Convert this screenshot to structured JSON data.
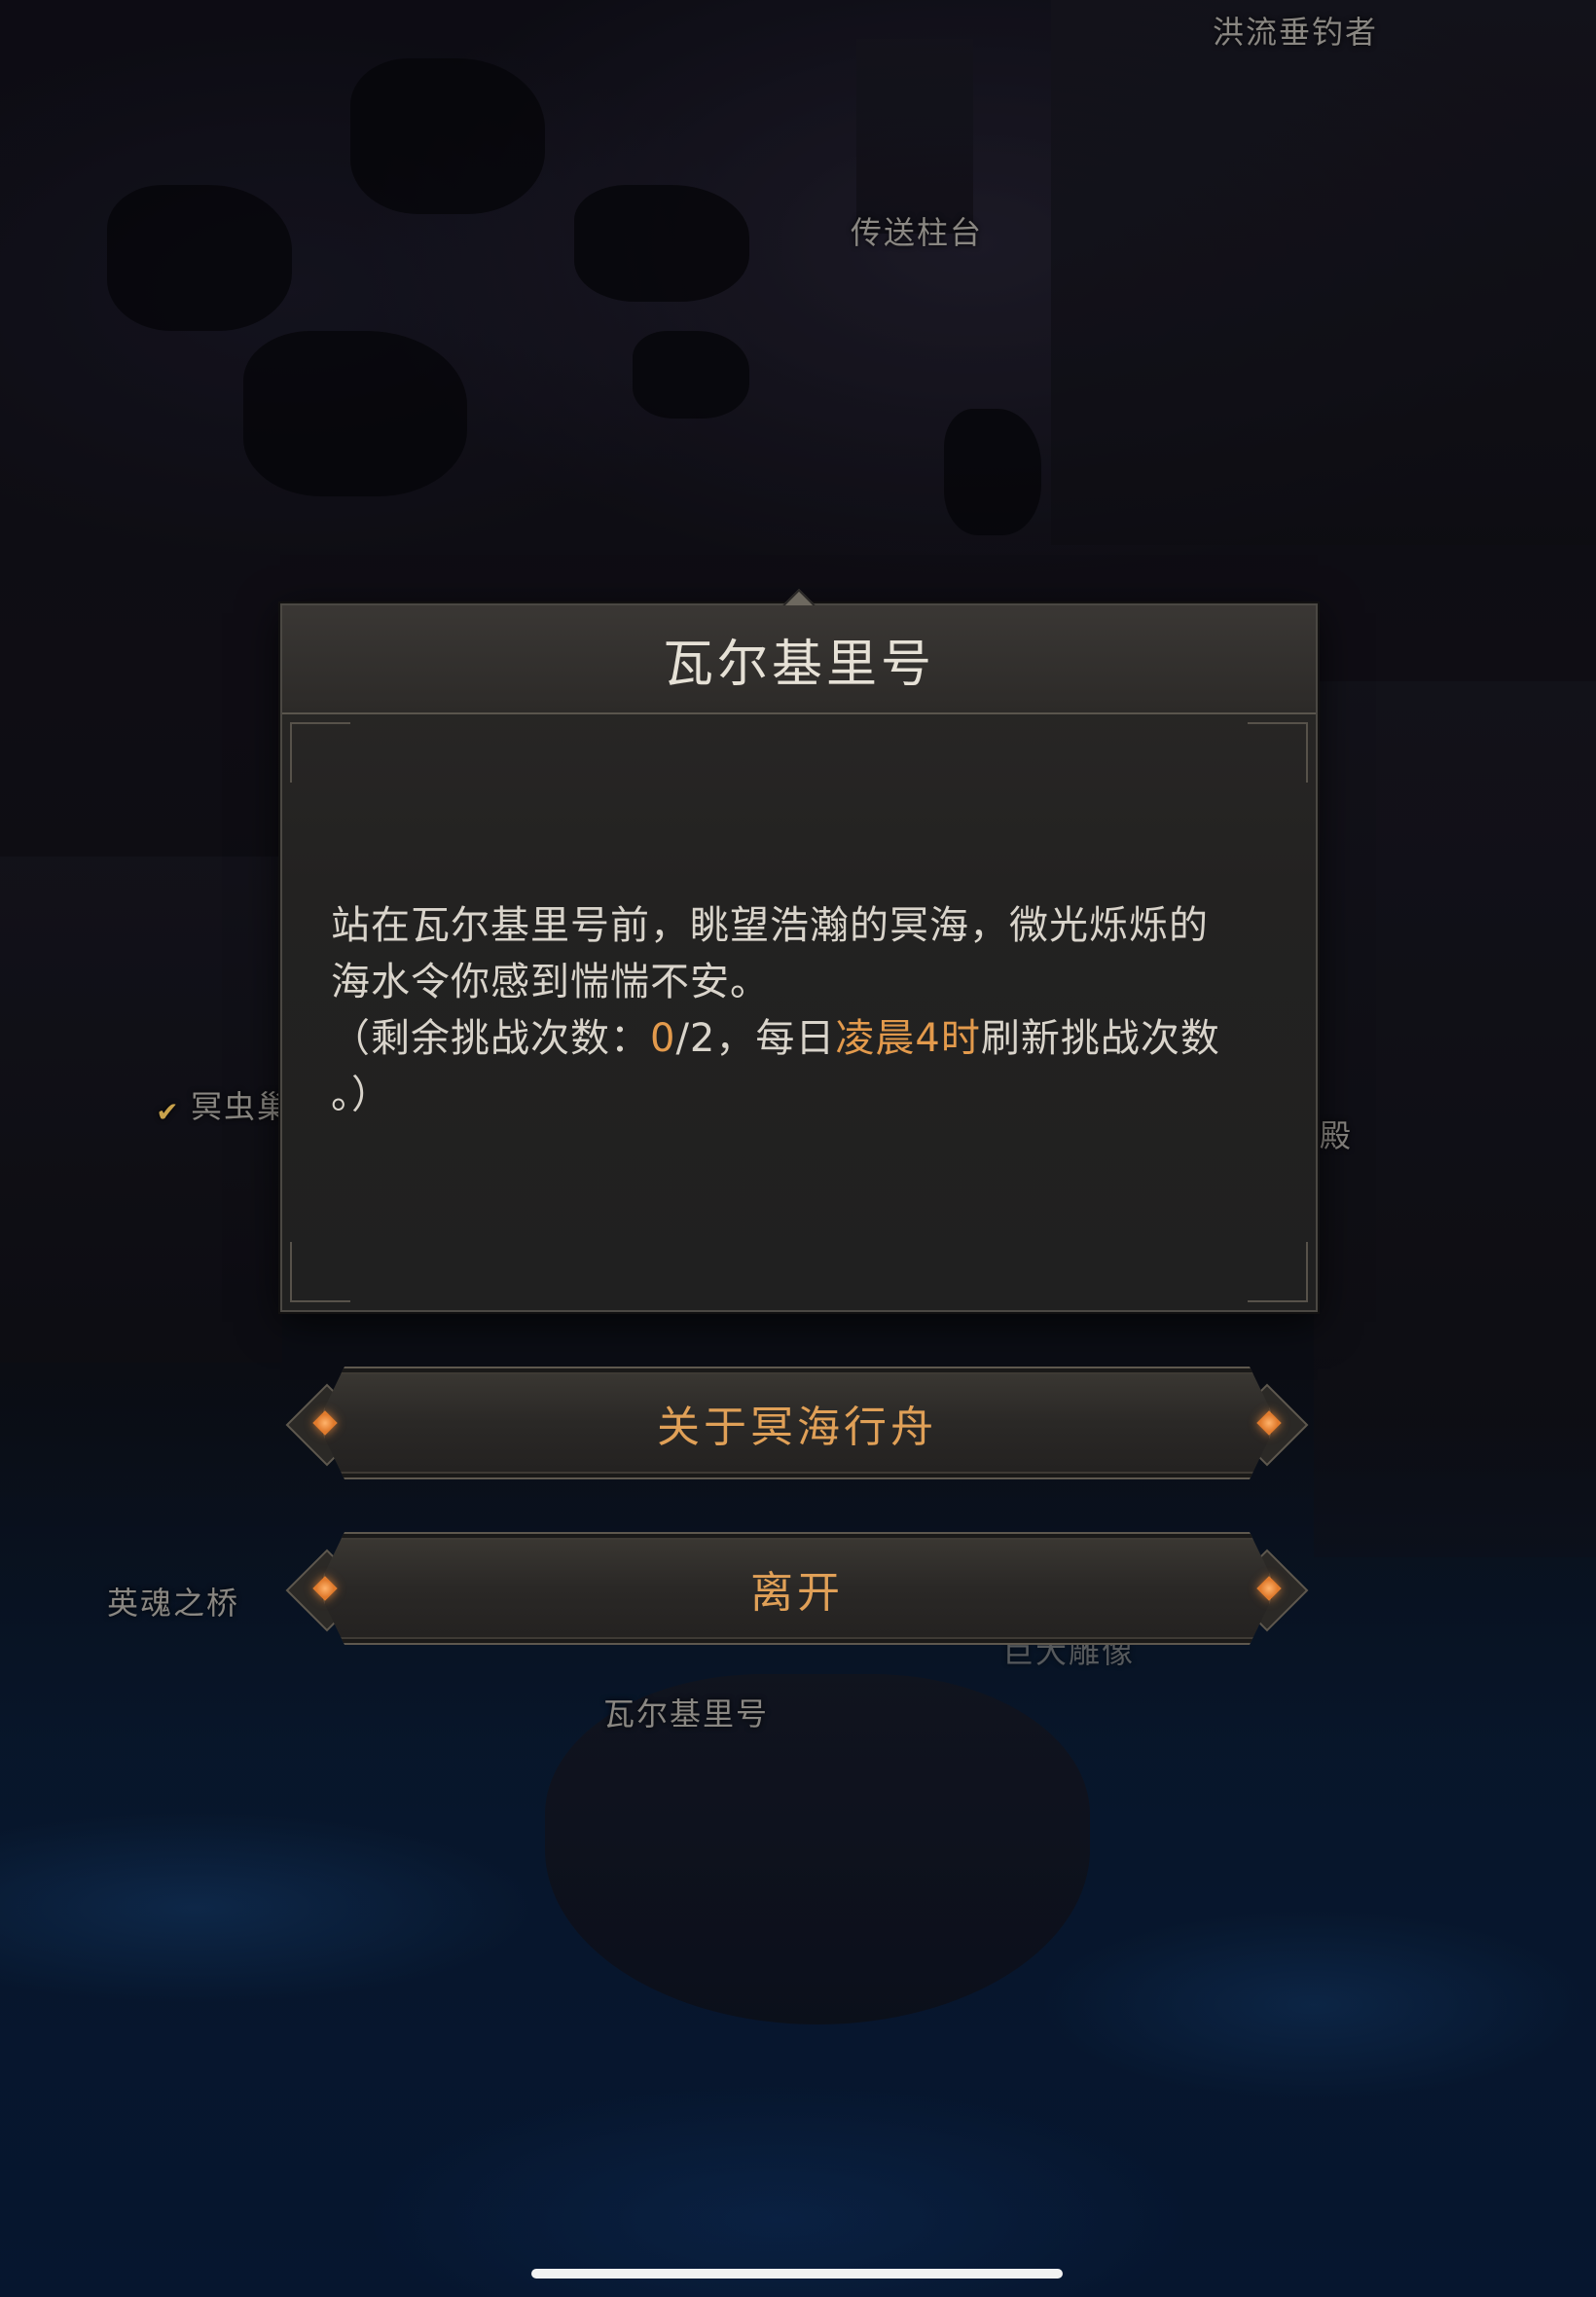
{
  "map_labels": {
    "top_right": "洪流垂钓者",
    "teleport_pillar": "传送柱台",
    "left_node": "冥虫巢",
    "right_node": "殿",
    "hero_bridge": "英魂之桥",
    "ship": "瓦尔基里号",
    "statue": "巨大雕像"
  },
  "dialog": {
    "title": "瓦尔基里号",
    "text_line1": "站在瓦尔基里号前，眺望浩瀚的冥海，微光烁烁的",
    "text_line2": "海水令你感到惴惴不安。",
    "text_line3_pre": "（剩余挑战次数：",
    "remaining": "0",
    "text_line3_mid": "/2，每日",
    "refresh_time": "凌晨4时",
    "text_line3_post": "刷新挑战次数",
    "text_line4": "。）"
  },
  "buttons": {
    "about": "关于冥海行舟",
    "leave": "离开"
  },
  "colors": {
    "accent": "#e39a4c",
    "text": "#d9d4cb",
    "panel": "#232221"
  },
  "icons": {
    "checkmark": "checkmark-icon",
    "gem": "diamond-gem-icon"
  }
}
